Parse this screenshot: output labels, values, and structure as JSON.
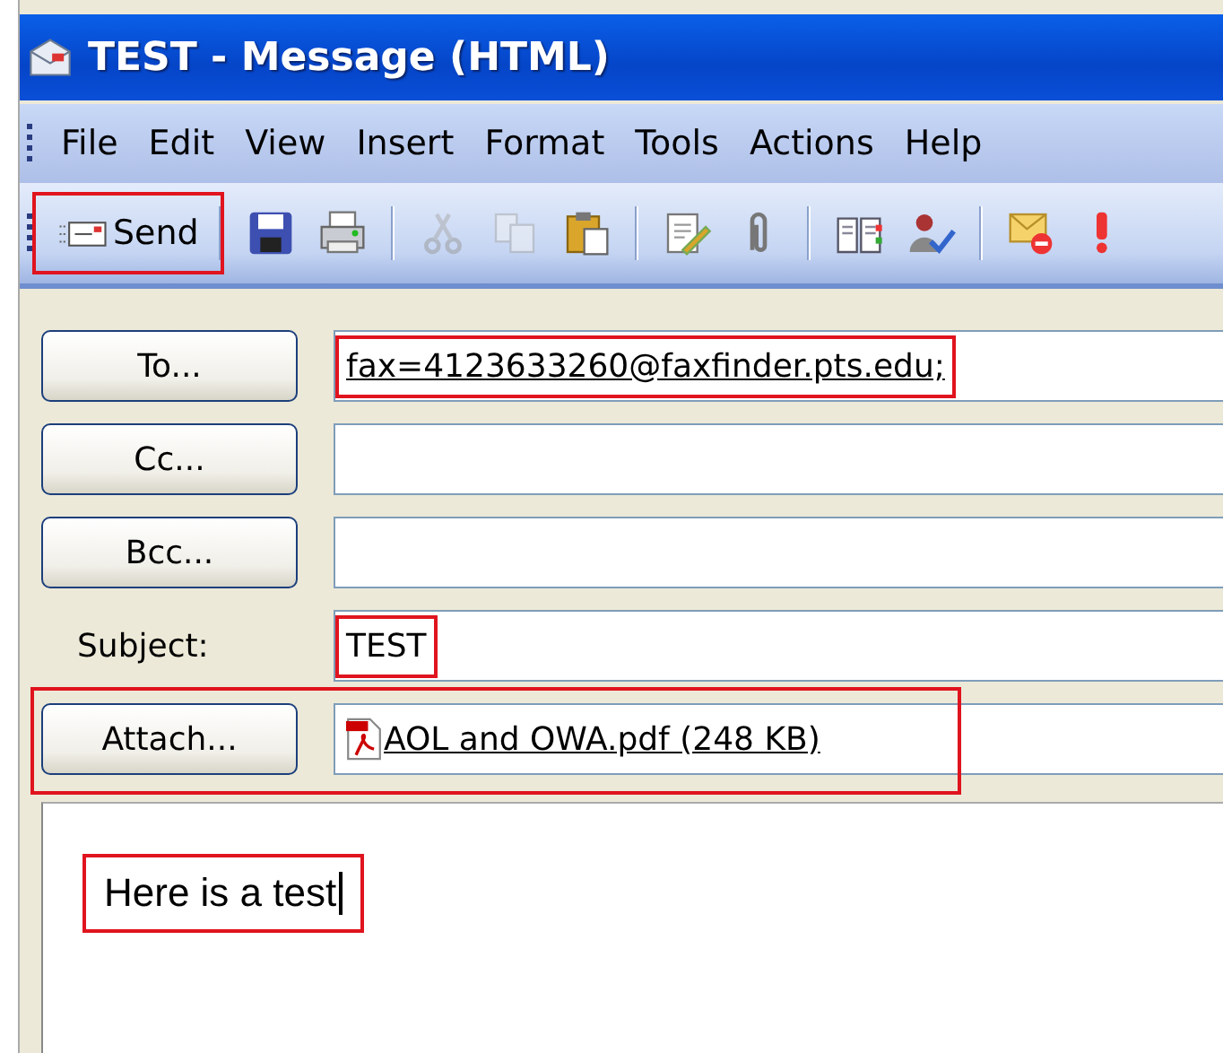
{
  "window": {
    "title": "TEST - Message (HTML)"
  },
  "menu": [
    {
      "label": "File"
    },
    {
      "label": "Edit"
    },
    {
      "label": "View"
    },
    {
      "label": "Insert"
    },
    {
      "label": "Format"
    },
    {
      "label": "Tools"
    },
    {
      "label": "Actions"
    },
    {
      "label": "Help"
    }
  ],
  "toolbar": [
    {
      "kind": "send",
      "label": "Send",
      "highlighted": true
    },
    {
      "kind": "sep"
    },
    {
      "kind": "save",
      "disabled": false
    },
    {
      "kind": "print",
      "disabled": false
    },
    {
      "kind": "sep"
    },
    {
      "kind": "cut",
      "disabled": true
    },
    {
      "kind": "copy",
      "disabled": true
    },
    {
      "kind": "paste",
      "disabled": false
    },
    {
      "kind": "sep"
    },
    {
      "kind": "signature",
      "disabled": false
    },
    {
      "kind": "attach",
      "disabled": false
    },
    {
      "kind": "sep"
    },
    {
      "kind": "addressbook",
      "disabled": false
    },
    {
      "kind": "checknames",
      "disabled": false
    },
    {
      "kind": "sep"
    },
    {
      "kind": "noreply",
      "disabled": false
    },
    {
      "kind": "importance",
      "disabled": false
    }
  ],
  "fields": [
    {
      "kind": "button",
      "label": "To...",
      "value": "fax=4123633260@faxfinder.pts.edu;",
      "link": true,
      "highlighted": true
    },
    {
      "kind": "button",
      "label": "Cc..."
    },
    {
      "kind": "button",
      "label": "Bcc..."
    },
    {
      "kind": "label",
      "label": "Subject:",
      "value": "TEST",
      "link": false,
      "highlighted": true
    },
    {
      "kind": "attach",
      "label": "Attach...",
      "value": "AOL and OWA.pdf (248 KB)",
      "link": true,
      "highlighted": true
    }
  ],
  "body": {
    "text": "Here is a test",
    "cursor": true,
    "highlighted": true
  }
}
